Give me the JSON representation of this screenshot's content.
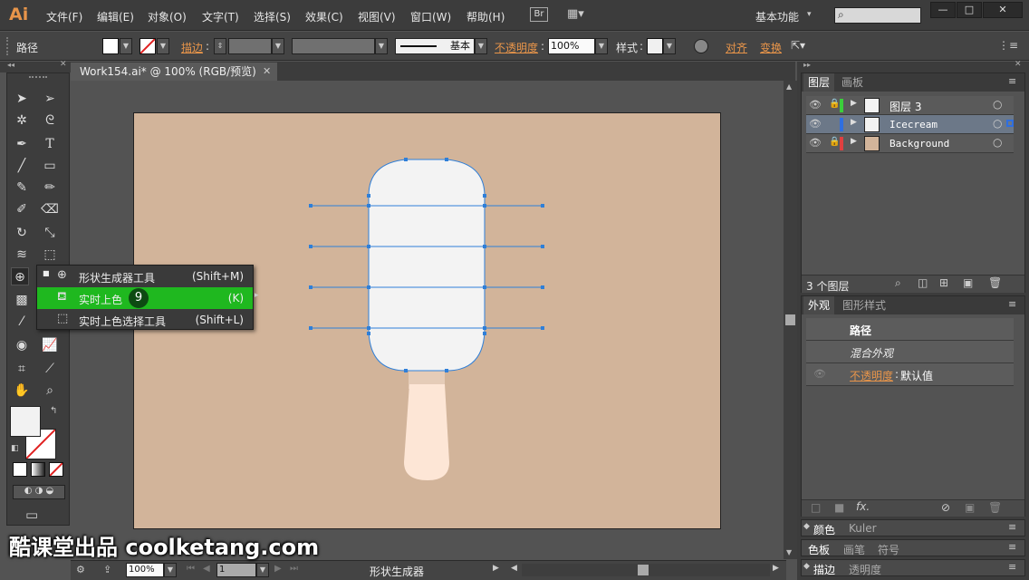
{
  "app": {
    "logo": "Ai",
    "menu": [
      "文件(F)",
      "编辑(E)",
      "对象(O)",
      "文字(T)",
      "选择(S)",
      "效果(C)",
      "视图(V)",
      "窗口(W)",
      "帮助(H)"
    ],
    "bridge": "Br",
    "workspace": "基本功能",
    "window_controls": [
      "—",
      "□",
      "✕"
    ]
  },
  "control_bar": {
    "selection": "路径",
    "stroke_label": "描边",
    "stroke_style": "基本",
    "opacity_label": "不透明度",
    "opacity_value": "100%",
    "style_label": "样式",
    "align_label": "对齐",
    "transform_label": "变换"
  },
  "document": {
    "tab_title": "Work154.ai* @ 100% (RGB/预览)",
    "close": "✕"
  },
  "flyout": {
    "items": [
      {
        "label": "形状生成器工具",
        "shortcut": "(Shift+M)",
        "active": false,
        "bullet": "■"
      },
      {
        "label": "实时上色",
        "shortcut": "(K)",
        "active": true,
        "badge": "9"
      },
      {
        "label": "实时上色选择工具",
        "shortcut": "(Shift+L)",
        "active": false
      }
    ]
  },
  "layers_panel": {
    "tabs": [
      "图层",
      "画板"
    ],
    "layers": [
      {
        "name": "图层 3",
        "color": "#3bcf3b",
        "thumb": "#f2f2f2",
        "locked": true,
        "selected": false
      },
      {
        "name": "Icecream",
        "color": "#2f6fe0",
        "thumb": "#f2f2f2",
        "locked": false,
        "selected": true
      },
      {
        "name": "Background",
        "color": "#e04040",
        "thumb": "#d2b49a",
        "locked": true,
        "selected": false
      }
    ],
    "count": "3 个图层"
  },
  "appearance_panel": {
    "tabs": [
      "外观",
      "图形样式"
    ],
    "title": "路径",
    "mixed": "混合外观",
    "opacity_label": "不透明度",
    "opacity_value": "默认值"
  },
  "collapsed_panels": [
    {
      "tabs": [
        "颜色",
        "Kuler"
      ]
    },
    {
      "tabs": [
        "色板",
        "画笔",
        "符号"
      ]
    },
    {
      "tabs": [
        "描边",
        "透明度"
      ]
    }
  ],
  "status_bar": {
    "zoom": "100%",
    "page": "1",
    "tool": "形状生成器"
  },
  "watermark": "酷课堂出品 coolketang.com",
  "colors": {
    "artboard": "#d2b49a",
    "selection": "#2f7fd8",
    "popsicle_body": "#f3f3f3",
    "stick": "#fde6d6",
    "active_item": "#1fb81f",
    "accent": "#e8954a"
  }
}
